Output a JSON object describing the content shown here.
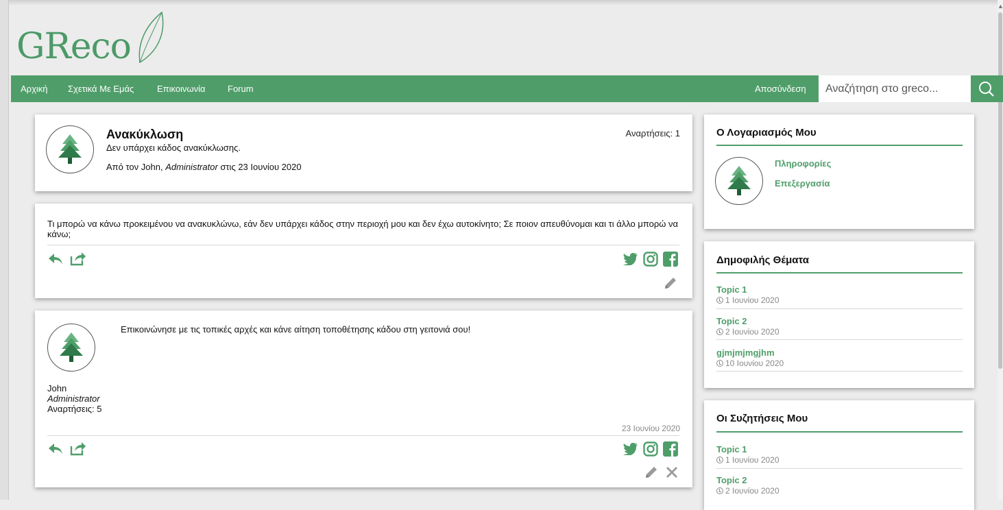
{
  "brand": {
    "logo_text": "GReco",
    "accent": "#4f9e6a"
  },
  "nav": {
    "items": [
      "Αρχική",
      "Σχετικά Με Εμάς",
      "Επικοινωνία",
      "Forum"
    ],
    "logout": "Αποσύνδεση",
    "search_placeholder": "Αναζήτηση στο greco..."
  },
  "topic": {
    "title": "Ανακύκλωση",
    "subtitle": "Δεν υπάρχει κάδος ανακύκλωσης.",
    "meta_prefix": "Από τον John, ",
    "meta_role": "Administrator",
    "meta_suffix": " στις 23 Ιουνίου 2020",
    "posts_count": "Αναρτήσεις: 1"
  },
  "first_post": {
    "text": "Τι μπορώ να κάνω προκειμένου να ανακυκλώνω, εάν δεν υπάρχει κάδος στην περιοχή μου και δεν έχω αυτοκίνητο; Σε ποιον απευθύνομαι και τι άλλο μπορώ να κάνω;"
  },
  "reply": {
    "text": "Επικοινώνησε με τις τοπικές αρχές και κάνε αίτηση τοποθέτησης κάδου στη γειτονιά σου!",
    "author": "John",
    "role": "Administrator",
    "posts": "Αναρτήσεις: 5",
    "date": "23 Ιουνίου 2020"
  },
  "account": {
    "title": "Ο Λογαριασμός Μου",
    "links": [
      "Πληροφορίες",
      "Επεξεργασία"
    ]
  },
  "popular": {
    "title": "Δημοφιλής Θέματα",
    "topics": [
      {
        "title": "Topic 1",
        "date": "1 Ιουνίου 2020"
      },
      {
        "title": "Topic 2",
        "date": "2 Ιουνίου 2020"
      },
      {
        "title": "gjmjmjmgjhm",
        "date": "10 Ιουνίου 2020"
      }
    ]
  },
  "my_discussions": {
    "title": "Οι Συζητήσεις Μου",
    "topics": [
      {
        "title": "Topic 1",
        "date": "1 Ιουνίου 2020"
      },
      {
        "title": "Topic 2",
        "date": "2 Ιουνίου 2020"
      }
    ]
  },
  "icons": {
    "reply": "reply-icon",
    "share": "share-icon",
    "twitter": "twitter-icon",
    "instagram": "instagram-icon",
    "facebook": "facebook-icon",
    "edit": "pencil-icon",
    "delete": "close-icon",
    "search": "search-icon",
    "clock": "clock-icon",
    "avatar": "tree-avatar-icon"
  }
}
